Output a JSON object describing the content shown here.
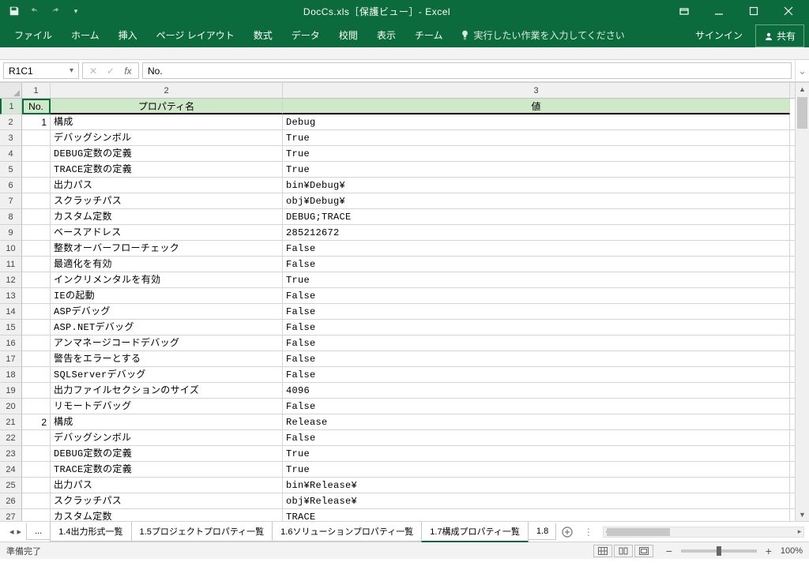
{
  "title": "DocCs.xls［保護ビュー］- Excel",
  "ribbon": {
    "file": "ファイル",
    "tabs": [
      "ホーム",
      "挿入",
      "ページ レイアウト",
      "数式",
      "データ",
      "校閲",
      "表示",
      "チーム"
    ],
    "tellme": "実行したい作業を入力してください",
    "signin": "サインイン",
    "share": "共有"
  },
  "namebox": "R1C1",
  "formula": "No.",
  "colHeaders": [
    "1",
    "2",
    "3"
  ],
  "headerRow": {
    "no": "No.",
    "prop": "プロパティ名",
    "val": "値"
  },
  "rows": [
    {
      "n": "1",
      "no": "1",
      "prop": "構成",
      "val": "Debug"
    },
    {
      "n": "2",
      "no": "",
      "prop": "デバッグシンボル",
      "val": "True"
    },
    {
      "n": "3",
      "no": "",
      "prop": "DEBUG定数の定義",
      "val": "True"
    },
    {
      "n": "4",
      "no": "",
      "prop": "TRACE定数の定義",
      "val": "True"
    },
    {
      "n": "5",
      "no": "",
      "prop": "出力パス",
      "val": "bin¥Debug¥"
    },
    {
      "n": "6",
      "no": "",
      "prop": "スクラッチパス",
      "val": "obj¥Debug¥"
    },
    {
      "n": "7",
      "no": "",
      "prop": "カスタム定数",
      "val": "DEBUG;TRACE"
    },
    {
      "n": "8",
      "no": "",
      "prop": "ベースアドレス",
      "val": "285212672"
    },
    {
      "n": "9",
      "no": "",
      "prop": "整数オーバーフローチェック",
      "val": "False"
    },
    {
      "n": "10",
      "no": "",
      "prop": "最適化を有効",
      "val": "False"
    },
    {
      "n": "11",
      "no": "",
      "prop": "インクリメンタルを有効",
      "val": "True"
    },
    {
      "n": "12",
      "no": "",
      "prop": "IEの起動",
      "val": "False"
    },
    {
      "n": "13",
      "no": "",
      "prop": "ASPデバッグ",
      "val": "False"
    },
    {
      "n": "14",
      "no": "",
      "prop": "ASP.NETデバッグ",
      "val": "False"
    },
    {
      "n": "15",
      "no": "",
      "prop": "アンマネージコードデバッグ",
      "val": "False"
    },
    {
      "n": "16",
      "no": "",
      "prop": "警告をエラーとする",
      "val": "False"
    },
    {
      "n": "17",
      "no": "",
      "prop": "SQLServerデバッグ",
      "val": "False"
    },
    {
      "n": "18",
      "no": "",
      "prop": "出力ファイルセクションのサイズ",
      "val": "4096"
    },
    {
      "n": "19",
      "no": "",
      "prop": "リモートデバッグ",
      "val": "False"
    },
    {
      "n": "20",
      "no": "2",
      "prop": "構成",
      "val": "Release"
    },
    {
      "n": "21",
      "no": "",
      "prop": "デバッグシンボル",
      "val": "False"
    },
    {
      "n": "22",
      "no": "",
      "prop": "DEBUG定数の定義",
      "val": "True"
    },
    {
      "n": "23",
      "no": "",
      "prop": "TRACE定数の定義",
      "val": "True"
    },
    {
      "n": "24",
      "no": "",
      "prop": "出力パス",
      "val": "bin¥Release¥"
    },
    {
      "n": "25",
      "no": "",
      "prop": "スクラッチパス",
      "val": "obj¥Release¥"
    },
    {
      "n": "26",
      "no": "",
      "prop": "カスタム定数",
      "val": "TRACE"
    }
  ],
  "sheetTabs": {
    "prevTrunc": "...",
    "tabs": [
      "1.4出力形式一覧",
      "1.5プロジェクトプロパティ一覧",
      "1.6ソリューションプロパティ一覧",
      "1.7構成プロパティ一覧"
    ],
    "nextTrunc": "1.8",
    "activeIndex": 3
  },
  "status": "準備完了",
  "zoom": "100%"
}
